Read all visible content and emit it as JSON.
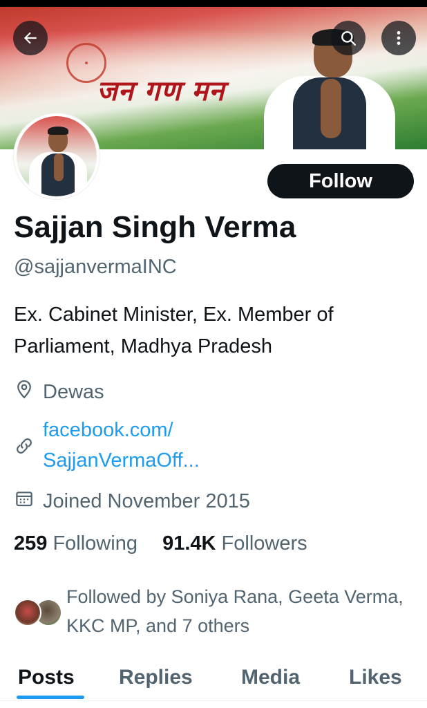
{
  "colors": {
    "accent": "#1d9bf0",
    "text_primary": "#0f1419",
    "text_secondary": "#536471",
    "follow_button_bg": "#0f1419"
  },
  "banner": {
    "text": "जन गण मन"
  },
  "toolbar": {
    "back_icon": "arrow-left-icon",
    "search_icon": "search-icon",
    "more_icon": "more-vertical-icon"
  },
  "profile": {
    "follow_label": "Follow",
    "name": "Sajjan Singh Verma",
    "handle": "@sajjanvermaINC",
    "bio": "Ex. Cabinet Minister, Ex. Member of Parliament, Madhya Pradesh",
    "location": "Dewas",
    "link_line1": "facebook.com/",
    "link_line2": "SajjanVermaOff...",
    "joined": "Joined November 2015"
  },
  "stats": {
    "following_count": "259",
    "following_label": "Following",
    "followers_count": "91.4K",
    "followers_label": "Followers"
  },
  "followed_by": {
    "text": "Followed by Soniya Rana, Geeta Verma, KKC MP, and 7 others"
  },
  "tabs": [
    {
      "label": "Posts",
      "active": true
    },
    {
      "label": "Replies",
      "active": false
    },
    {
      "label": "Media",
      "active": false
    },
    {
      "label": "Likes",
      "active": false
    }
  ]
}
